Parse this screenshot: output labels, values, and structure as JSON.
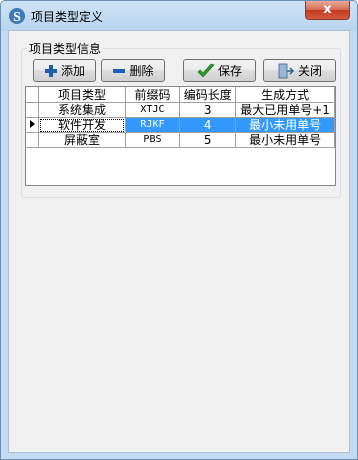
{
  "window": {
    "title": "项目类型定义",
    "close_glyph": "x"
  },
  "group": {
    "label": "项目类型信息"
  },
  "toolbar": {
    "add_label": "添加",
    "delete_label": "删除",
    "save_label": "保存",
    "close_label": "关闭"
  },
  "table": {
    "columns": [
      "项目类型",
      "前缀码",
      "编码长度",
      "生成方式"
    ],
    "rows": [
      {
        "name": "系统集成",
        "prefix": "XTJC",
        "length": "3",
        "method": "最大已用单号+1"
      },
      {
        "name": "软件开发",
        "prefix": "RJKF",
        "length": "4",
        "method": "最小未用单号",
        "selected": true
      },
      {
        "name": "屏蔽室",
        "prefix": "PBS",
        "length": "5",
        "method": "最小未用单号"
      }
    ],
    "selected_row": 1
  },
  "colors": {
    "selection": "#3399ff",
    "title_bg": "#c4daf0",
    "close_btn": "#c4391f"
  }
}
